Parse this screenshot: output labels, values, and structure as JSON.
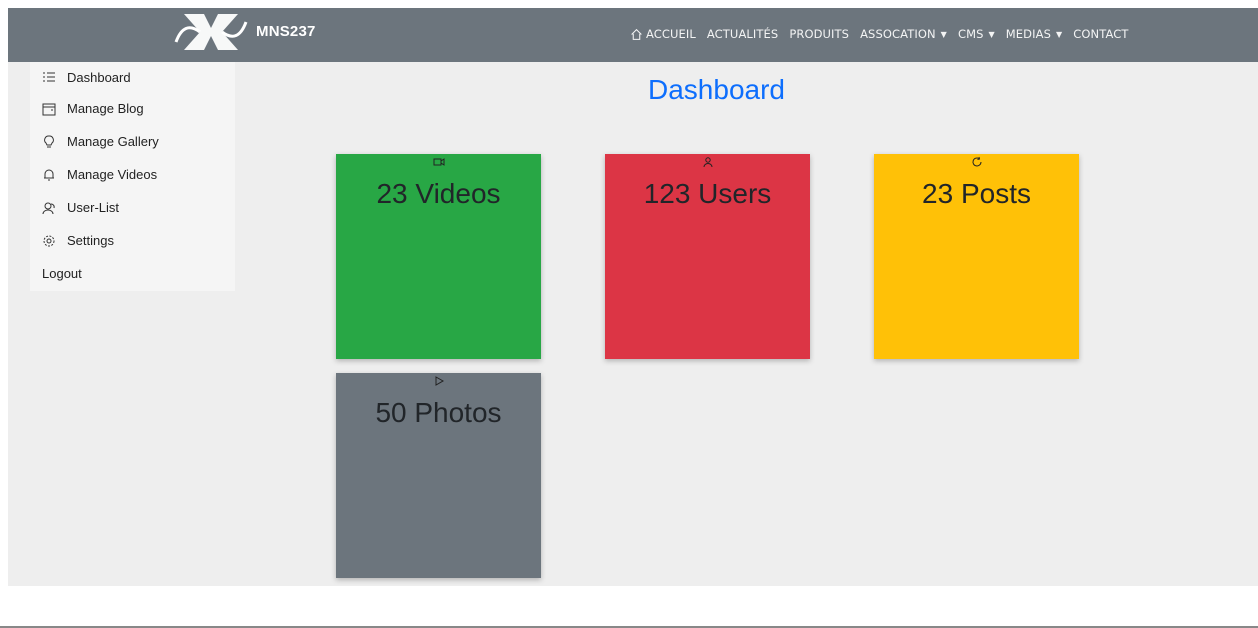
{
  "navbar": {
    "brand": "MNS237",
    "links": [
      {
        "label": "ACCUEIL",
        "icon": "home-icon"
      },
      {
        "label": "ACTUALITÉS"
      },
      {
        "label": "PRODUITS"
      },
      {
        "label": "ASSOCATION",
        "dropdown": true
      },
      {
        "label": "CMS",
        "dropdown": true
      },
      {
        "label": "MEDIAS",
        "dropdown": true
      },
      {
        "label": "CONTACT"
      }
    ],
    "color": "#6c757d"
  },
  "sidebar": {
    "items": [
      {
        "label": "Dashboard",
        "icon": "list-icon"
      },
      {
        "label": "Manage Blog",
        "icon": "blog-icon"
      },
      {
        "label": "Manage Gallery",
        "icon": "lightbulb-icon"
      },
      {
        "label": "Manage Videos",
        "icon": "bell-icon"
      },
      {
        "label": "User-List",
        "icon": "users-icon"
      },
      {
        "label": "Settings",
        "icon": "gear-icon"
      },
      {
        "label": "Logout"
      }
    ]
  },
  "main": {
    "title": "Dashboard",
    "title_color": "#0d6efd",
    "cards": [
      {
        "label": "23 Videos",
        "icon": "video-icon",
        "color": "#28a745"
      },
      {
        "label": "123 Users",
        "icon": "person-icon",
        "color": "#dc3545"
      },
      {
        "label": "23 Posts",
        "icon": "refresh-icon",
        "color": "#ffc107"
      },
      {
        "label": "50 Photos",
        "icon": "play-icon",
        "color": "#6c757d"
      }
    ]
  }
}
